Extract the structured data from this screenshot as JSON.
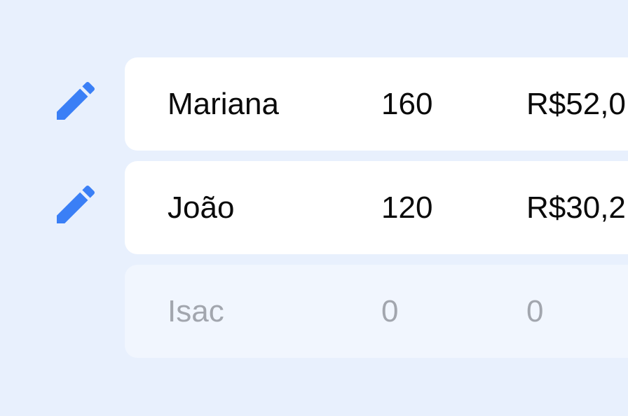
{
  "colors": {
    "background": "#e8f0fd",
    "row_active": "#ffffff",
    "row_inactive": "#f1f6fe",
    "icon": "#3a7ff6",
    "text_active": "#0a0a0a",
    "text_inactive": "#a2a6ae"
  },
  "rows": [
    {
      "name": "Mariana",
      "qty": "160",
      "value": "R$52,0",
      "edit_icon": "pencil-icon",
      "active": true
    },
    {
      "name": "João",
      "qty": "120",
      "value": "R$30,2",
      "edit_icon": "pencil-icon",
      "active": true
    },
    {
      "name": "Isac",
      "qty": "0",
      "value": "0",
      "active": false
    }
  ]
}
